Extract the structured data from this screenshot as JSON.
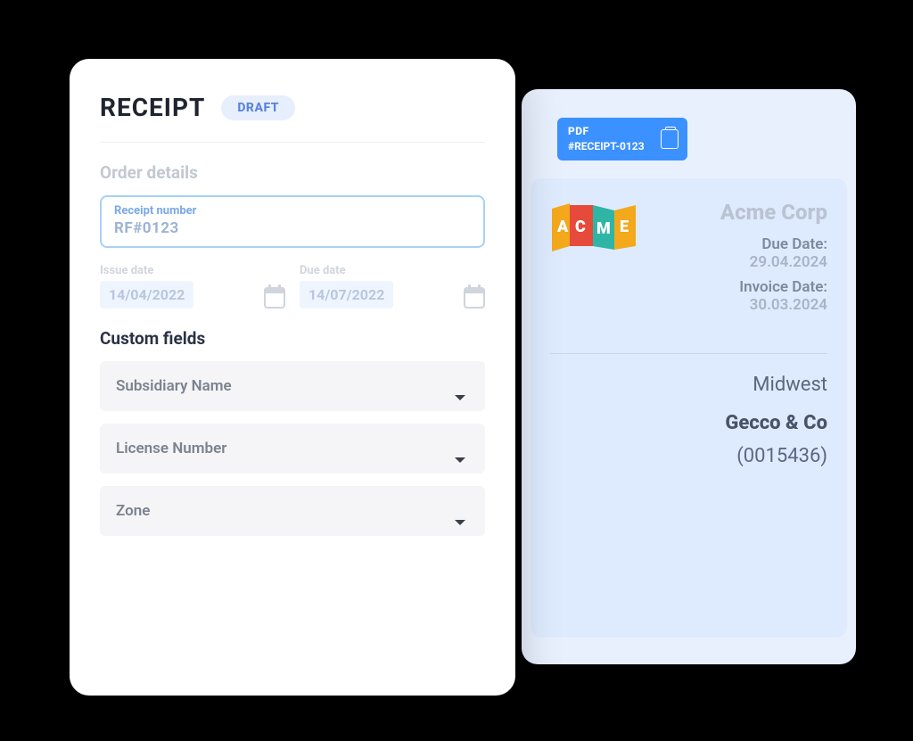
{
  "form": {
    "title": "RECEIPT",
    "badge": "DRAFT",
    "order_details_label": "Order details",
    "receipt_number": {
      "label": "Receipt number",
      "value": "RF#0123"
    },
    "issue_date": {
      "label": "Issue date",
      "value": "14/04/2022"
    },
    "due_date": {
      "label": "Due date",
      "value": "14/07/2022"
    },
    "custom_fields_label": "Custom fields",
    "selects": {
      "subsidiary": "Subsidiary Name",
      "license": "License Number",
      "zone": "Zone"
    }
  },
  "preview": {
    "pdf": {
      "type": "PDF",
      "filename": "#RECEIPT-0123"
    },
    "company": "Acme Corp",
    "due_date_label": "Due Date:",
    "due_date_value": "29.04.2024",
    "invoice_date_label": "Invoice Date:",
    "invoice_date_value": "30.03.2024",
    "region": "Midwest",
    "company2": "Gecco & Co",
    "idnum": "(0015436)"
  }
}
